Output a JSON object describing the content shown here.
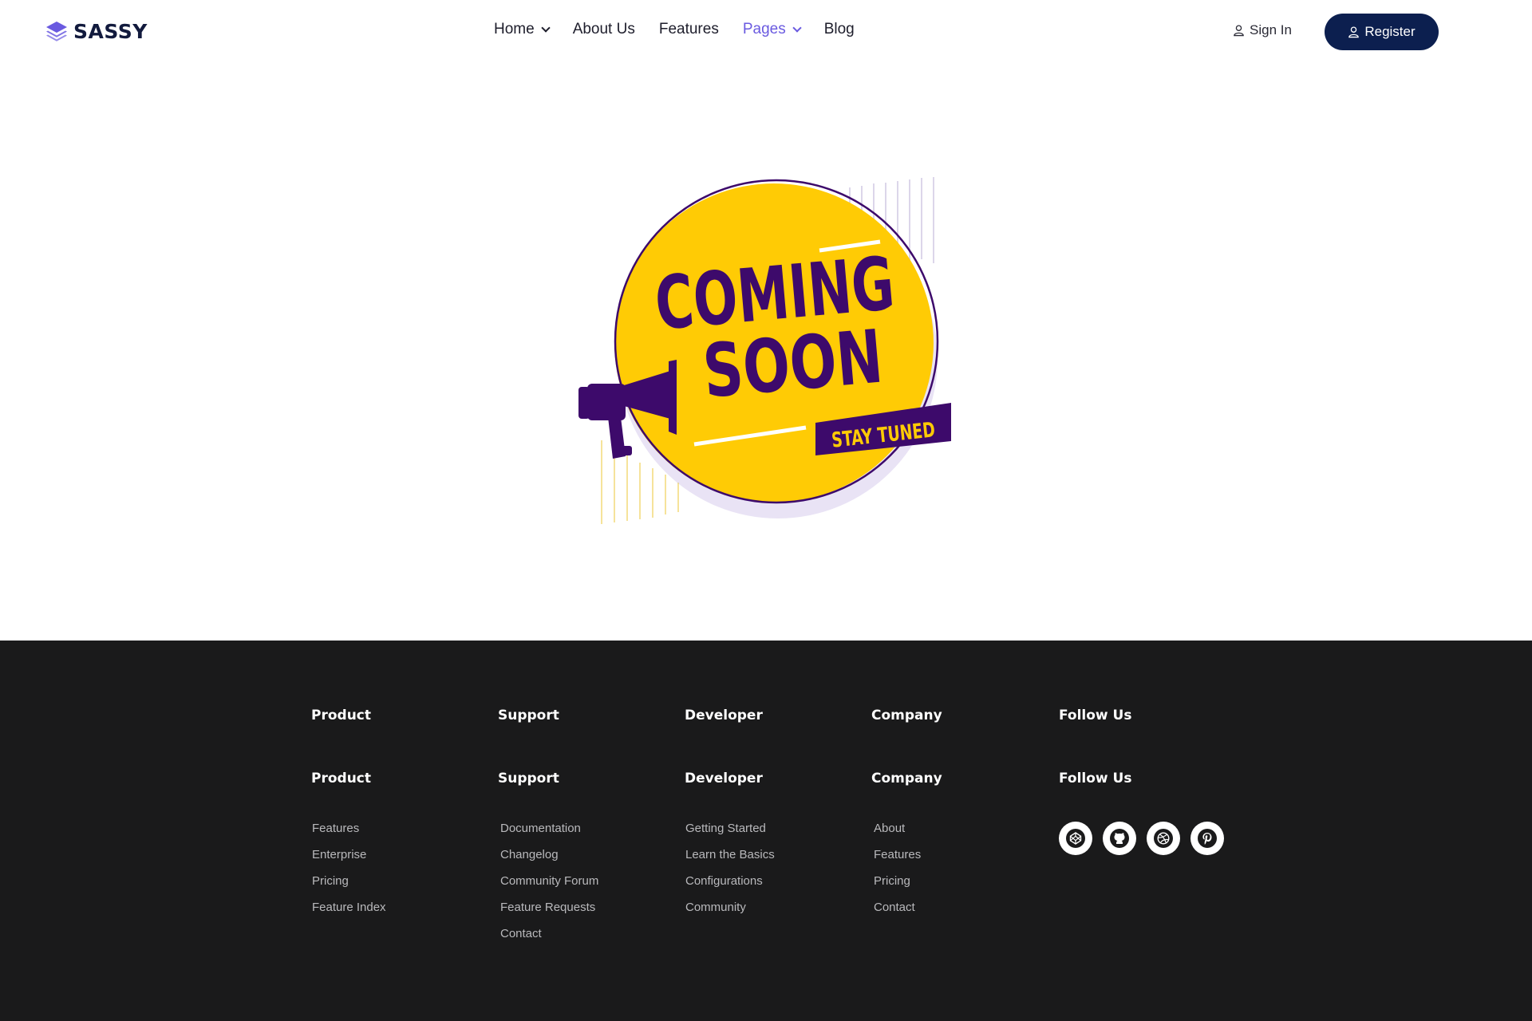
{
  "brand": {
    "name": "SASSY",
    "accent": "#6a5ae0",
    "dark": "#0c1f4f"
  },
  "nav": {
    "items": [
      {
        "label": "Home",
        "has_dropdown": true
      },
      {
        "label": "About Us",
        "has_dropdown": false
      },
      {
        "label": "Features",
        "has_dropdown": false
      },
      {
        "label": "Pages",
        "has_dropdown": true,
        "active": true
      },
      {
        "label": "Blog",
        "has_dropdown": false
      }
    ],
    "signin_label": "Sign In",
    "register_label": "Register"
  },
  "hero": {
    "line1": "COMING",
    "line2": "SOON",
    "tag": "STAY TUNED",
    "icon": "megaphone-icon",
    "colors": {
      "circle": "#ffcb05",
      "ink": "#3d0a6b"
    }
  },
  "footer": {
    "top_headings": [
      "Product",
      "Support",
      "Developer",
      "Company",
      "Follow Us"
    ],
    "columns": [
      {
        "heading": "Product",
        "links": [
          "Features",
          "Enterprise",
          "Pricing",
          "Feature Index"
        ]
      },
      {
        "heading": "Support",
        "links": [
          "Documentation",
          "Changelog",
          "Community Forum",
          "Feature Requests",
          "Contact"
        ]
      },
      {
        "heading": "Developer",
        "links": [
          "Getting Started",
          "Learn the Basics",
          "Configurations",
          "Community"
        ]
      },
      {
        "heading": "Company",
        "links": [
          "About",
          "Features",
          "Pricing",
          "Contact"
        ]
      }
    ],
    "follow_heading": "Follow Us",
    "social": [
      "codepen-icon",
      "github-icon",
      "dribbble-icon",
      "pinterest-icon"
    ]
  }
}
